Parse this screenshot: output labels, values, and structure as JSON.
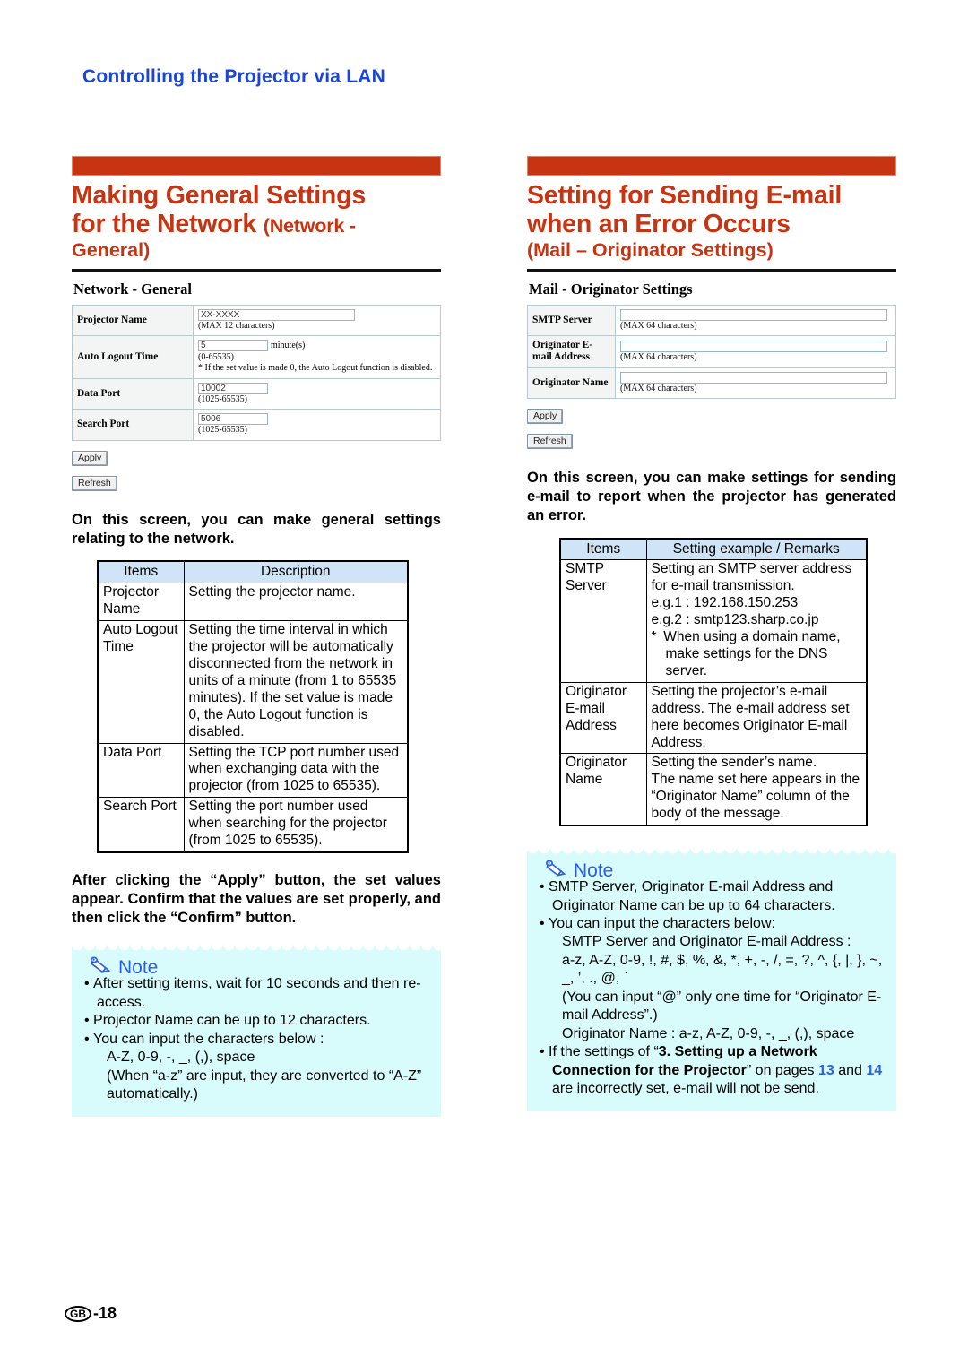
{
  "running_head": "Controlling the Projector via LAN",
  "page_number": "-18",
  "page_locale": "GB",
  "colors": {
    "heading_blue": "#1a45d8",
    "section_red": "#c63411",
    "note_bg": "#d8fbfb",
    "note_blue": "#2b5fe0",
    "table_header_blue": "#cfe5f7"
  },
  "left": {
    "title_main": "Making General Settings",
    "title_line2": "for the Network ",
    "title_paren": "(Network -",
    "title_line3": "General)",
    "screenshot": {
      "heading": "Network - General",
      "rows": [
        {
          "label": "Projector Name",
          "field_value": "XX-XXXX",
          "field_width": 175,
          "unit": "",
          "hints": [
            "(MAX 12 characters)"
          ]
        },
        {
          "label": "Auto Logout Time",
          "field_value": "5",
          "field_width": 78,
          "unit": "minute(s)",
          "hints": [
            "(0-65535)",
            "* If the set value is made 0, the Auto Logout function is disabled."
          ]
        },
        {
          "label": "Data Port",
          "field_value": "10002",
          "field_width": 78,
          "unit": "",
          "hints": [
            "(1025-65535)"
          ]
        },
        {
          "label": "Search Port",
          "field_value": "5006",
          "field_width": 78,
          "unit": "",
          "hints": [
            "(1025-65535)"
          ]
        }
      ],
      "apply_label": "Apply",
      "refresh_label": "Refresh"
    },
    "intro": "On this screen, you can make general settings relating to the network.",
    "table": {
      "headers": [
        "Items",
        "Description"
      ],
      "rows": [
        {
          "item": "Projector Name",
          "description": "Setting the projector name."
        },
        {
          "item": "Auto Logout Time",
          "description": "Setting the time interval in which the projector will be automatically disconnected from the network in units of a minute (from 1 to 65535 minutes). If the set value is made 0, the Auto Logout function is disabled."
        },
        {
          "item": "Data Port",
          "description": "Setting the TCP port number used when exchanging data with the projector (from 1025 to 65535)."
        },
        {
          "item": "Search Port",
          "description": "Setting the port number used when searching for the projector (from 1025 to 65535)."
        }
      ]
    },
    "after_apply": "After clicking the “Apply” button, the set values appear. Confirm that the values are set properly, and then click the “Confirm” button.",
    "note": {
      "title": "Note",
      "bullets": [
        {
          "text": "After setting items, wait for 10 seconds and then re-access.",
          "extra": []
        },
        {
          "text": "Projector Name can be up to 12 characters.",
          "extra": []
        },
        {
          "text": "You can input the characters below :",
          "extra": [
            "A-Z, 0-9, -, _, (,), space",
            "(When “a-z” are input, they are converted to “A-Z” automatically.)"
          ]
        }
      ]
    }
  },
  "right": {
    "title_main": "Setting for Sending E-mail",
    "title_line2": "when an Error Occurs",
    "title_sub": "(Mail – Originator Settings)",
    "screenshot": {
      "heading": "Mail - Originator Settings",
      "rows": [
        {
          "label": "SMTP Server",
          "field_value": "",
          "hints": [
            "(MAX 64 characters)"
          ]
        },
        {
          "label": "Originator E-mail Address",
          "field_value": "",
          "hints": [
            "(MAX 64 characters)"
          ]
        },
        {
          "label": "Originator Name",
          "field_value": "",
          "hints": [
            "(MAX 64 characters)"
          ]
        }
      ],
      "apply_label": "Apply",
      "refresh_label": "Refresh"
    },
    "intro": "On this screen, you can make settings for sending e-mail to report when the projector has generated an error.",
    "table": {
      "headers": [
        "Items",
        "Setting example / Remarks"
      ],
      "rows": [
        {
          "item": "SMTP Server",
          "lines": [
            "Setting an SMTP server address for e-mail transmission.",
            "e.g.1 : 192.168.150.253",
            "e.g.2 : smtp123.sharp.co.jp",
            "* When using a domain name, make settings for the DNS server."
          ]
        },
        {
          "item": "Originator E-mail Address",
          "lines": [
            "Setting the projector’s e-mail address. The e-mail address set here becomes Originator E-mail Address."
          ]
        },
        {
          "item": "Originator Name",
          "lines": [
            "Setting the sender’s name.",
            "The name set here appears in the “Originator Name” column of the body of the message."
          ]
        }
      ]
    },
    "note": {
      "title": "Note",
      "bullet1": "SMTP Server, Originator E-mail Address and Originator Name can be up to 64 characters.",
      "bullet2": "You can input the characters below:",
      "bullet2_lines": [
        "SMTP Server and Originator E-mail Address :",
        "a-z, A-Z, 0-9, !, #, $, %, &, *, +, -, /, =, ?, ^, {, |, }, ~, _, ’, ., @, `",
        "(You can input “@” only one time for “Originator E-mail Address”.)",
        "Originator Name : a-z, A-Z, 0-9, -, _, (,), space"
      ],
      "bullet3_a": "If the settings of “",
      "bullet3_bold": "3. Setting up a Network Connection for the Projector",
      "bullet3_b": "” on pages ",
      "bullet3_page1": "13",
      "bullet3_c": " and ",
      "bullet3_page2": "14",
      "bullet3_d": " are incorrectly set, e-mail will not be send."
    }
  }
}
